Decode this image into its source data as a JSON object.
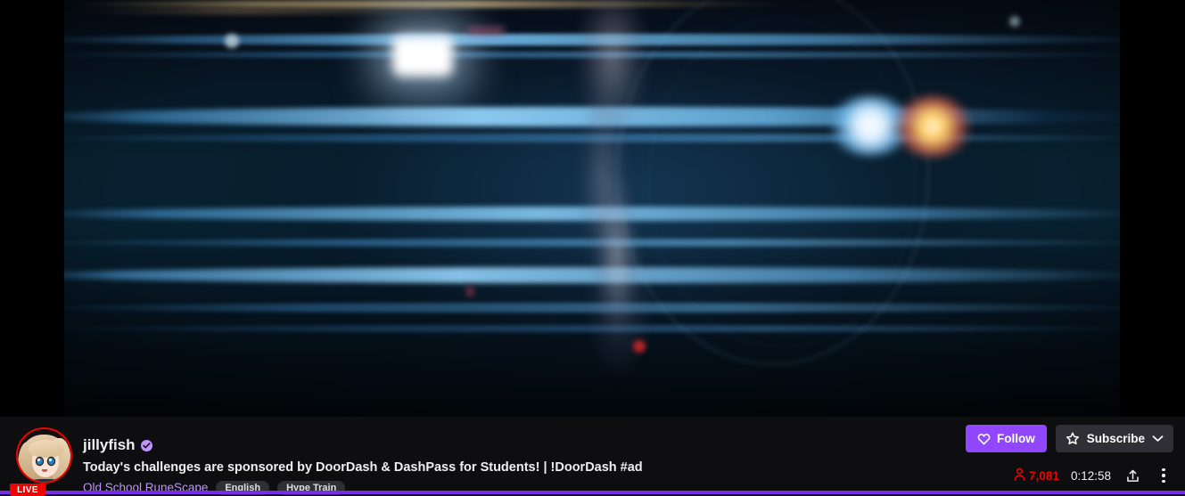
{
  "player": {
    "name": "video-player",
    "scene_description": "motion-blurred night scene with horizontal blue light streaks and bright headlights"
  },
  "channel": {
    "username": "jillyfish",
    "verified": true,
    "verified_icon": "verified-check-icon",
    "live_badge": "LIVE",
    "avatar_alt": "jillyfish avatar",
    "stream_title": "Today's challenges are sponsored by DoorDash & DashPass for Students! | !DoorDash #ad",
    "category": "Old School RuneScape",
    "tags": [
      "English",
      "Hype Train"
    ]
  },
  "actions": {
    "follow_label": "Follow",
    "follow_icon": "heart-icon",
    "subscribe_label": "Subscribe",
    "subscribe_icon": "star-icon",
    "subscribe_dropdown_icon": "chevron-down-icon"
  },
  "stats": {
    "viewer_icon": "viewer-person-icon",
    "viewer_count": "7,081",
    "uptime": "0:12:58",
    "share_icon": "share-upload-icon",
    "more_icon": "more-options-kebab-icon"
  },
  "colors": {
    "twitch_purple": "#9147ff",
    "hype_train_purple": "#772ce8",
    "live_red": "#eb0400",
    "category_link": "#bf94ff",
    "info_bar_bg": "#0e0e10",
    "button_gray": "#2f2f35"
  }
}
